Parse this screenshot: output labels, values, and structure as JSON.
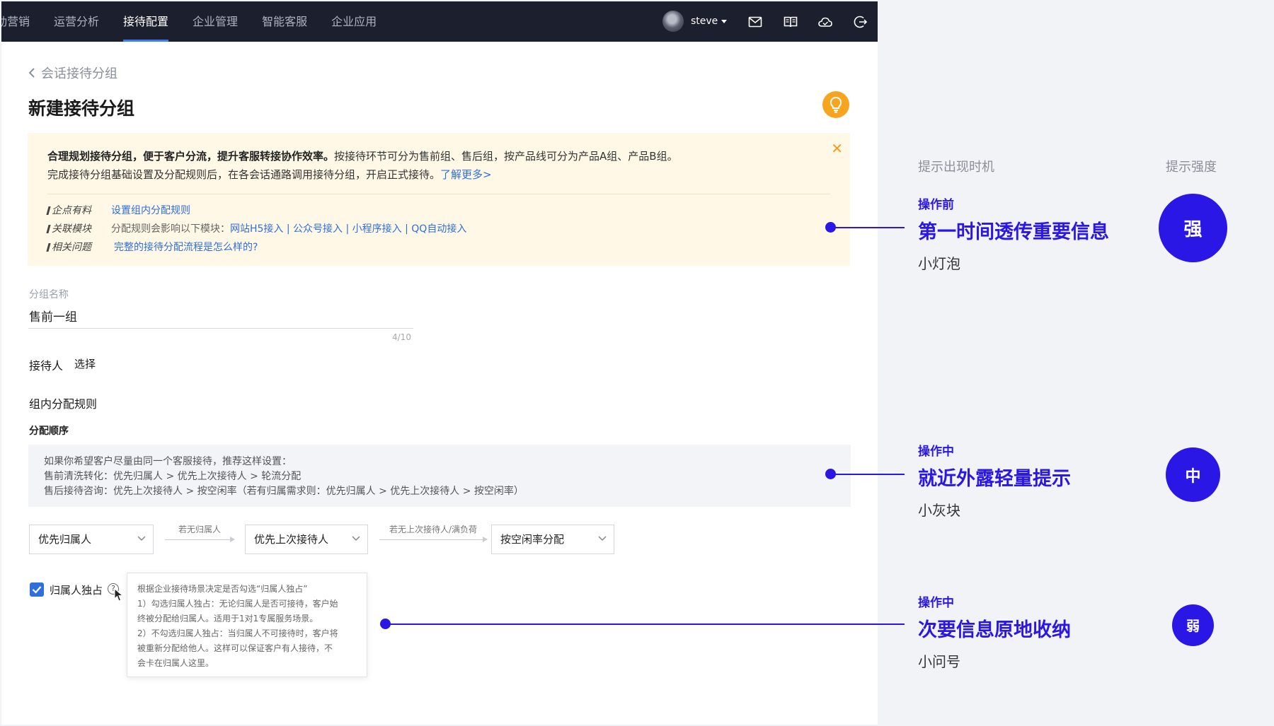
{
  "nav": {
    "items": [
      {
        "label": "动营销",
        "active": false
      },
      {
        "label": "运营分析",
        "active": false
      },
      {
        "label": "接待配置",
        "active": true
      },
      {
        "label": "企业管理",
        "active": false
      },
      {
        "label": "智能客服",
        "active": false
      },
      {
        "label": "企业应用",
        "active": false
      }
    ],
    "username": "steve"
  },
  "breadcrumb": "会话接待分组",
  "page_title": "新建接待分组",
  "notice": {
    "bold_text": "合理规划接待分组，便于客户分流，提升客服转接协作效率。",
    "text1": "按接待环节可分为售前组、售后组，按产品线可分为产品A组、产品B组。",
    "text2": "完成接待分组基础设置及分配规则后，在各会话通路调用接待分组，开启正式接待。",
    "learn_more": "了解更多>",
    "rows": [
      {
        "key": "企点有料",
        "desc": "",
        "links": "设置组内分配规则"
      },
      {
        "key": "关联模块",
        "desc": "分配规则会影响以下模块：",
        "links": "网站H5接入 | 公众号接入 | 小程序接入 | QQ自动接入"
      },
      {
        "key": "相关问题",
        "desc": "",
        "links": "完整的接待分配流程是怎么样的?"
      }
    ]
  },
  "group_name": {
    "label": "分组名称",
    "value": "售前一组",
    "count": "4/10"
  },
  "receiver": {
    "label": "接待人",
    "action": "选择"
  },
  "rules": {
    "title": "组内分配规则",
    "order_label": "分配顺序",
    "tip_lines": [
      "如果你希望客户尽量由同一个客服接待，推荐这样设置：",
      "售前清洗转化：优先归属人 > 优先上次接待人 > 轮流分配",
      "售后接待咨询：优先上次接待人 > 按空闲率（若有归属需求则：优先归属人 > 优先上次接待人 > 按空闲率）"
    ],
    "select1": "优先归属人",
    "arrow1": "若无归属人",
    "select2": "优先上次接待人",
    "arrow2": "若无上次接待人/满负荷",
    "select3": "按空闲率分配"
  },
  "exclusive": {
    "label": "归属人独占",
    "checked": true,
    "tooltip": [
      "根据企业接待场景决定是否勾选“归属人独占”",
      "1）勾选归属人独占：无论归属人是否可接待，客户始",
      "终被分配给归属人。适用于1对1专属服务场景。",
      "2）不勾选归属人独占：当归属人不可接待时，客户将",
      "被重新分配给他人。这样可以保证客户有人接待，不",
      "会卡在归属人这里。"
    ]
  },
  "right_panel": {
    "header_timing": "提示出现时机",
    "header_strength": "提示强度",
    "annotations": [
      {
        "timing": "操作前",
        "headline": "第一时间透传重要信息",
        "sub": "小灯泡",
        "strength": "强"
      },
      {
        "timing": "操作中",
        "headline": "就近外露轻量提示",
        "sub": "小灰块",
        "strength": "中"
      },
      {
        "timing": "操作中",
        "headline": "次要信息原地收纳",
        "sub": "小问号",
        "strength": "弱"
      }
    ]
  },
  "colors": {
    "accent": "#2a17e6",
    "link": "#2f6fdc",
    "bulb": "#f7a521",
    "topbar": "#1b1f2e",
    "notice_bg": "#fff8e6"
  }
}
